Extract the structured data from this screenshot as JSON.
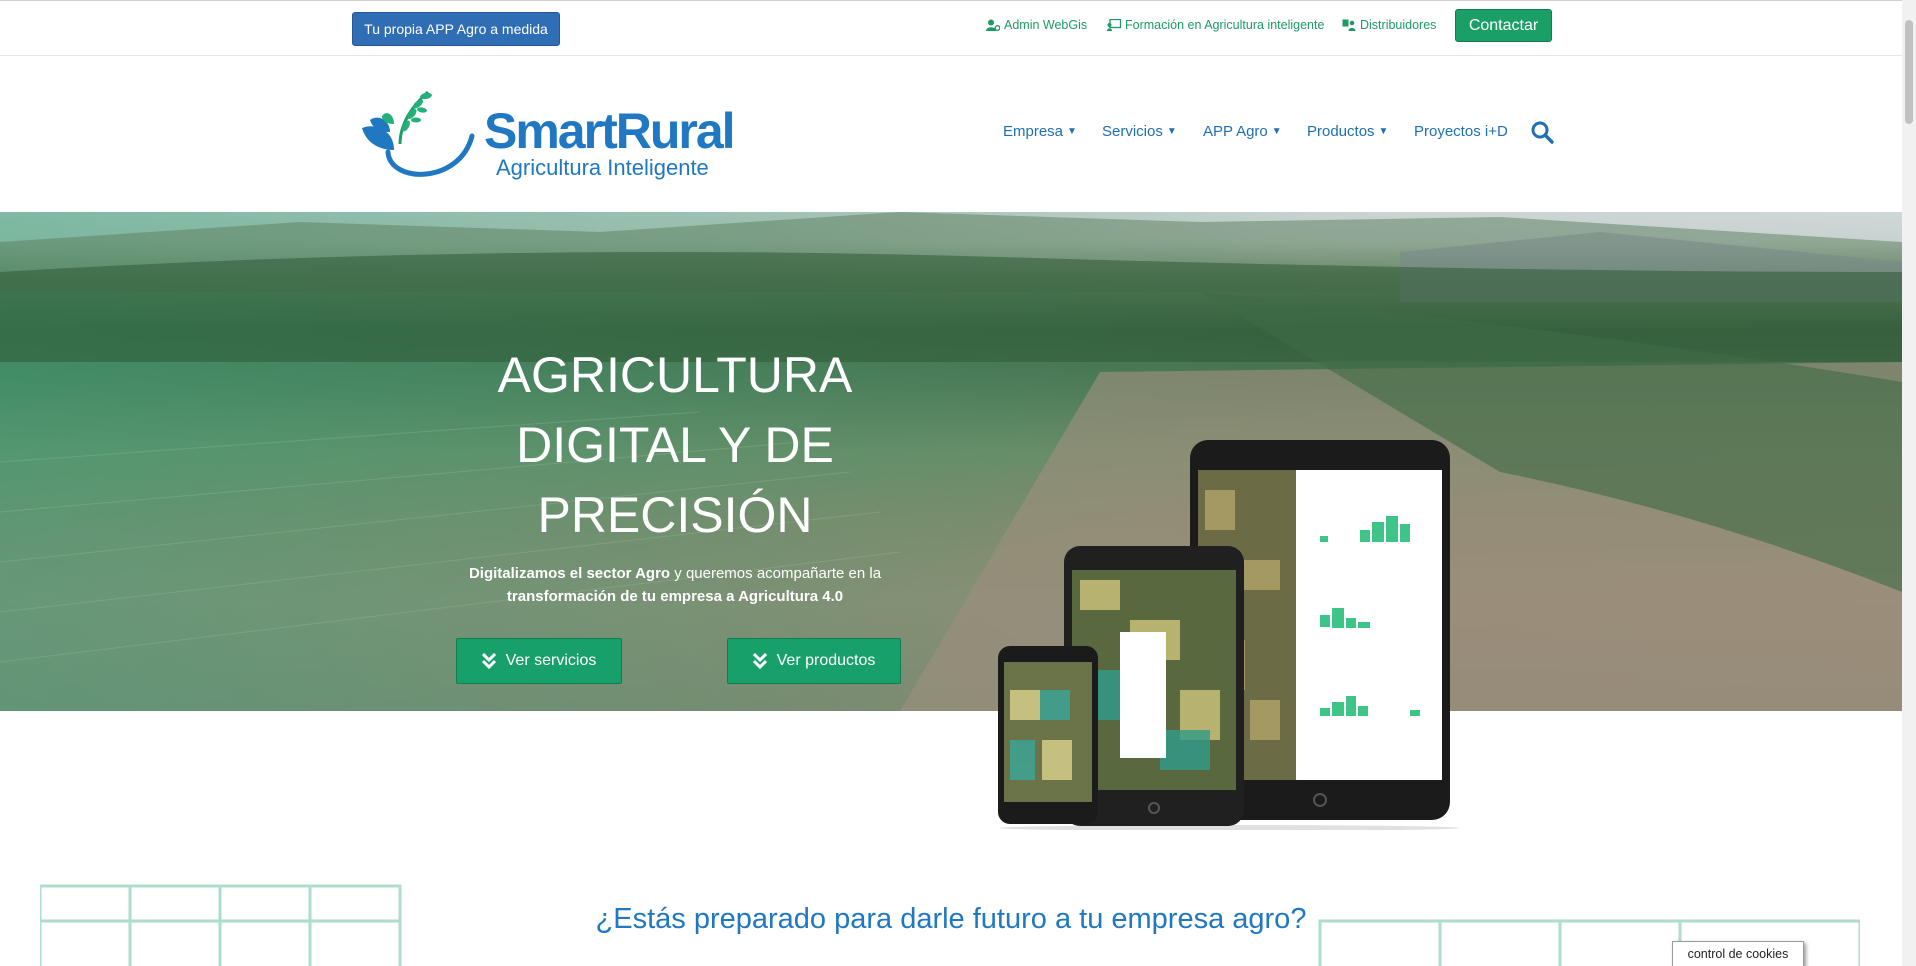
{
  "topbar": {
    "app_button": "Tu propia APP Agro a medida",
    "links": [
      {
        "label": "Admin WebGis",
        "icon": "user-cog-icon"
      },
      {
        "label": "Formación en Agricultura inteligente",
        "icon": "chalkboard-icon"
      },
      {
        "label": "Distribuidores",
        "icon": "users-icon"
      }
    ],
    "contact_button": "Contactar"
  },
  "header": {
    "logo_name": "SmartRural",
    "logo_tagline": "Agricultura Inteligente",
    "nav": [
      {
        "label": "Empresa",
        "dropdown": true
      },
      {
        "label": "Servicios",
        "dropdown": true
      },
      {
        "label": "APP Agro",
        "dropdown": true
      },
      {
        "label": "Productos",
        "dropdown": true
      },
      {
        "label": "Proyectos i+D",
        "dropdown": false
      }
    ],
    "search_icon": "search-icon"
  },
  "hero": {
    "title_lines": [
      "AGRICULTURA",
      "DIGITAL Y DE",
      "PRECISIÓN"
    ],
    "subtitle_bold_1": "Digitalizamos el sector Agro",
    "subtitle_normal": " y queremos acompañarte en la",
    "subtitle_bold_2": "transformación de tu empresa a Agricultura 4.0",
    "btn_services": "Ver servicios",
    "btn_products": "Ver productos",
    "btn_icon": "double-chevron-down-icon"
  },
  "section": {
    "question": "¿Estás preparado para darle futuro a tu empresa agro?"
  },
  "cookie_button": "control de cookies",
  "colors": {
    "brand_blue": "#1f78c1",
    "brand_green": "#1aa067",
    "app_button_blue": "#2f6db5"
  }
}
